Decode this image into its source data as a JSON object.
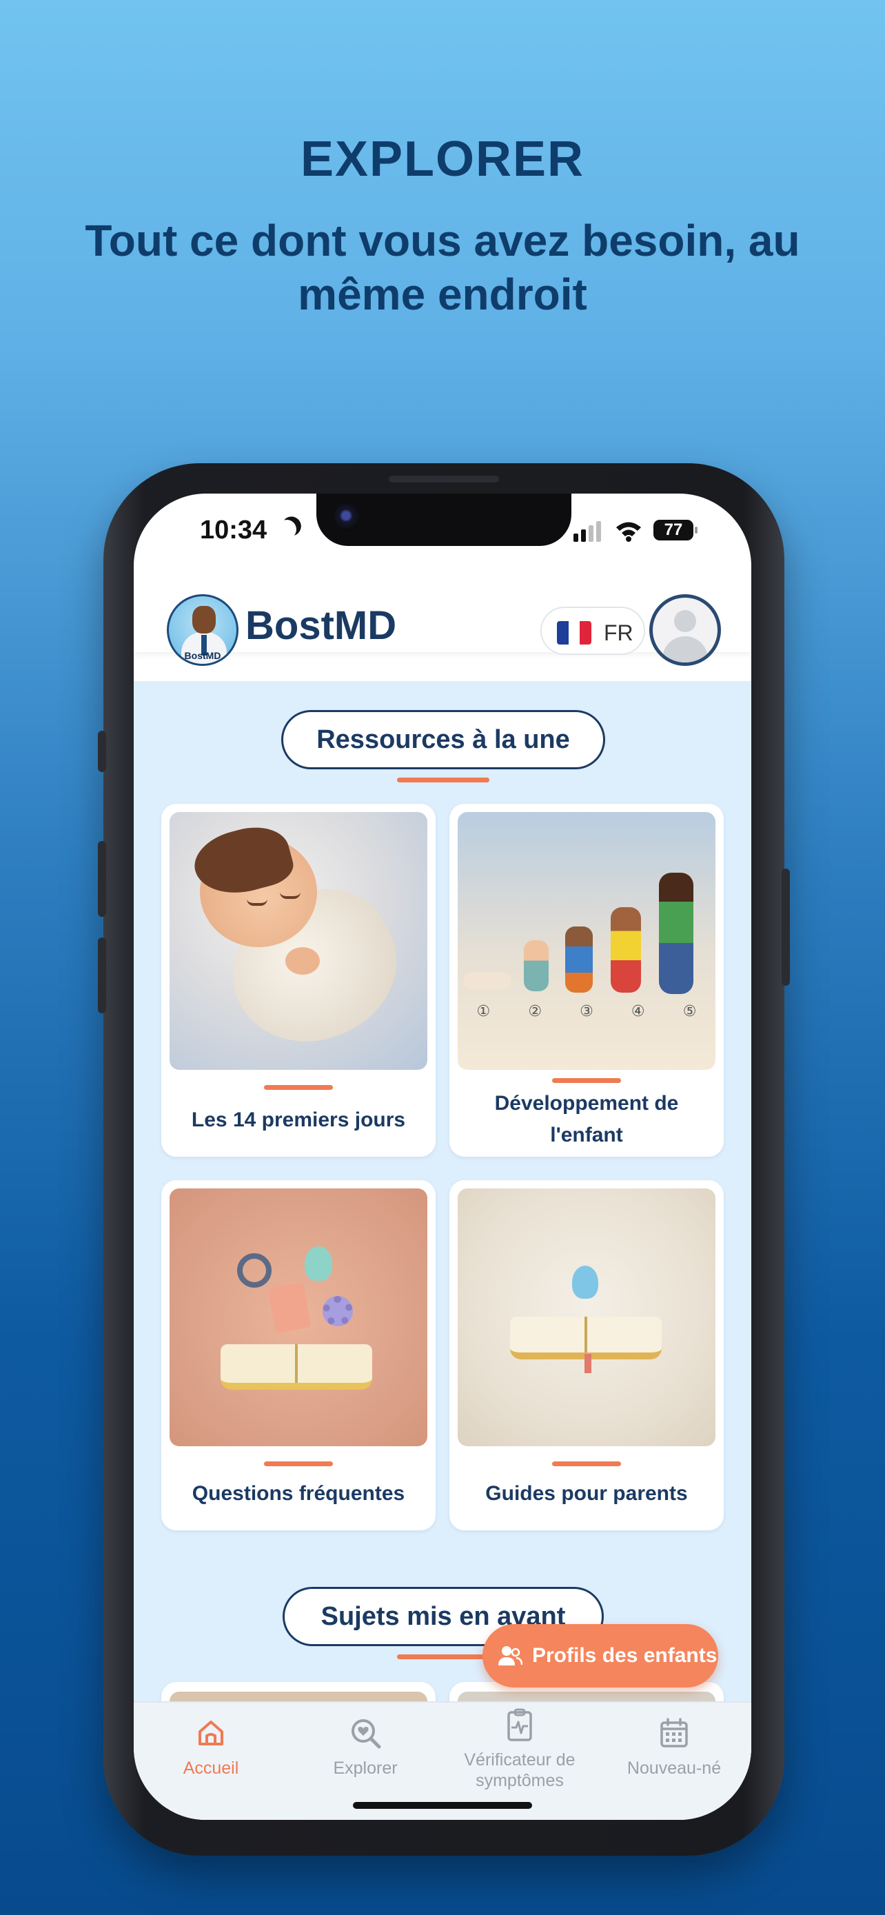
{
  "promo": {
    "title": "EXPLORER",
    "subtitle": "Tout ce dont vous avez besoin, au même endroit"
  },
  "status_bar": {
    "time": "10:34",
    "battery": "77"
  },
  "header": {
    "app_name": "BostMD",
    "logo_text": "BostMD",
    "language": "FR"
  },
  "featured": {
    "section_title": "Ressources à la une",
    "cards": [
      {
        "title": "Les 14 premiers jours",
        "icon": "sleeping-baby-illustration"
      },
      {
        "title": "Développement de l'enfant",
        "icon": "child-growth-stages-illustration"
      },
      {
        "title": "Questions fréquentes",
        "icon": "book-with-ideas-illustration"
      },
      {
        "title": "Guides pour parents",
        "icon": "open-book-lightbulb-illustration"
      }
    ],
    "growth_stage_numbers": [
      "①",
      "②",
      "③",
      "④",
      "⑤"
    ]
  },
  "topics": {
    "section_title": "Sujets mis en avant"
  },
  "fab": {
    "label": "Profils des enfants",
    "icon": "people-icon"
  },
  "tabbar": {
    "items": [
      {
        "label": "Accueil",
        "icon": "home-icon",
        "active": true
      },
      {
        "label": "Explorer",
        "icon": "search-heart-icon",
        "active": false
      },
      {
        "label": "Vérificateur de symptômes",
        "icon": "clipboard-pulse-icon",
        "active": false
      },
      {
        "label": "Nouveau-né",
        "icon": "calendar-icon",
        "active": false
      }
    ]
  },
  "colors": {
    "accent": "#f07a52",
    "primary": "#1b3a63",
    "content_bg": "#ddeefc",
    "fab": "#f5855c"
  }
}
